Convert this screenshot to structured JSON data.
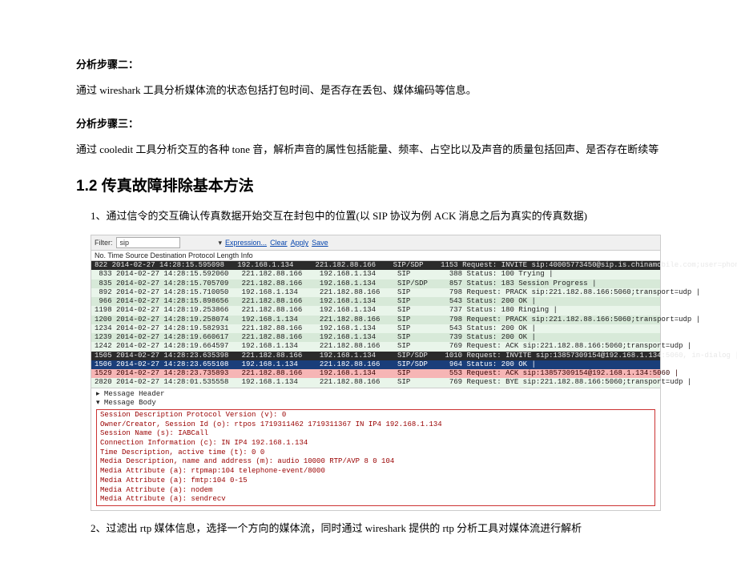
{
  "step2_title": "分析步骤二：",
  "step2_body": "通过 wireshark 工具分析媒体流的状态包括打包时间、是否存在丢包、媒体编码等信息。",
  "step3_title": "分析步骤三：",
  "step3_body": "通过 cooledit 工具分析交互的各种 tone 音，解析声音的属性包括能量、频率、占空比以及声音的质量包括回声、是否存在断续等",
  "section_heading": "1.2   传真故障排除基本方法",
  "item1": "1、通过信令的交互确认传真数据开始交互在封包中的位置(以 SIP 协议为例    ACK 消息之后为真实的传真数据)",
  "item2": "2、过滤出 rtp 媒体信息，选择一个方向的媒体流，同时通过 wireshark 提供的 rtp 分析工具对媒体流进行解析",
  "filter": {
    "label": "Filter:",
    "value": "sip",
    "exp": "Expression...",
    "clear": "Clear",
    "apply": "Apply",
    "save": "Save"
  },
  "cols": "No.   Time                         Source            Destination       Protocol   Length  Info",
  "rows": [
    {
      "cls": "r-dark",
      "t": "822 2014-02-27 14:28:15.595098   192.168.1.134     221.182.88.166    SIP/SDP    1153 Request: INVITE sip:40005773450@sip.is.chinamobile.com;user=phone |"
    },
    {
      "cls": "r-light",
      "t": " 833 2014-02-27 14:28:15.592060   221.182.88.166    192.168.1.134     SIP         388 Status: 100 Trying |"
    },
    {
      "cls": "r-light2",
      "t": " 835 2014-02-27 14:28:15.705709   221.182.88.166    192.168.1.134     SIP/SDP     857 Status: 183 Session Progress |"
    },
    {
      "cls": "r-light",
      "t": " 892 2014-02-27 14:28:15.710050   192.168.1.134     221.182.88.166    SIP         798 Request: PRACK sip:221.182.88.166:5060;transport=udp |"
    },
    {
      "cls": "r-light2",
      "t": " 966 2014-02-27 14:28:15.898656   221.182.88.166    192.168.1.134     SIP         543 Status: 200 OK |"
    },
    {
      "cls": "r-light",
      "t": "1198 2014-02-27 14:28:19.253866   221.182.88.166    192.168.1.134     SIP         737 Status: 180 Ringing |"
    },
    {
      "cls": "r-light2",
      "t": "1200 2014-02-27 14:28:19.258074   192.168.1.134     221.182.88.166    SIP         798 Request: PRACK sip:221.182.88.166:5060;transport=udp |"
    },
    {
      "cls": "r-light",
      "t": "1234 2014-02-27 14:28:19.582931   221.182.88.166    192.168.1.134     SIP         543 Status: 200 OK |"
    },
    {
      "cls": "r-light2",
      "t": "1239 2014-02-27 14:28:19.660617   221.182.88.166    192.168.1.134     SIP         739 Status: 200 OK |"
    },
    {
      "cls": "r-light",
      "t": "1242 2014-02-27 14:28:19.664597   192.168.1.134     221.182.88.166    SIP         769 Request: ACK sip:221.182.88.166:5060;transport=udp |"
    },
    {
      "cls": "r-dark",
      "t": "1505 2014-02-27 14:28:23.635398   221.182.88.166    192.168.1.134     SIP/SDP    1010 Request: INVITE sip:13857309154@192.168.1.134:5060, in-dialog |"
    },
    {
      "cls": "r-sel",
      "t": "1506 2014-02-27 14:28:23.655108   192.168.1.134     221.182.88.166    SIP/SDP     964 Status: 200 OK |"
    },
    {
      "cls": "r-red",
      "t": "1529 2014-02-27 14:28:23.735893   221.182.88.166    192.168.1.134     SIP         553 Request: ACK sip:13857309154@192.168.1.134:5060 |"
    },
    {
      "cls": "r-light",
      "t": "2820 2014-02-27 14:28:01.535558   192.168.1.134     221.182.88.166    SIP         769 Request: BYE sip:221.182.88.166:5060;transport=udp |"
    }
  ],
  "detail": {
    "l1": "▸ Message Header",
    "l2": "▾ Message Body",
    "l3": "Session Description Protocol Version (v): 0",
    "l4": "Owner/Creator, Session Id (o): rtpos 1719311462 1719311367 IN IP4 192.168.1.134",
    "l5": "Session Name (s): IABCall",
    "l6": "Connection Information (c): IN IP4 192.168.1.134",
    "l7": "Time Description, active time (t): 0 0",
    "l8": "Media Description, name and address (m): audio 10000 RTP/AVP 8 0 104",
    "l9": "Media Attribute (a): rtpmap:104 telephone-event/8000",
    "l10": "Media Attribute (a): fmtp:104 0-15",
    "l11": "Media Attribute (a): nodem",
    "l12": "Media Attribute (a): sendrecv"
  }
}
